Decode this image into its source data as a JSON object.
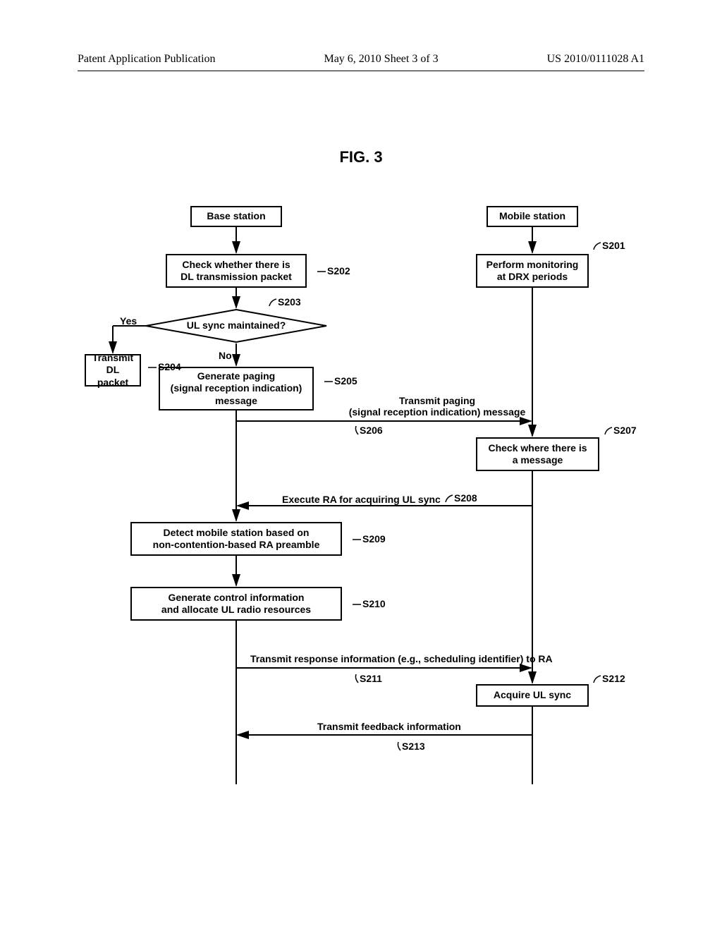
{
  "header": {
    "left": "Patent Application Publication",
    "center": "May 6, 2010  Sheet 3 of 3",
    "right": "US 2010/0111028 A1"
  },
  "figure_title": "FIG. 3",
  "boxes": {
    "base_station": "Base station",
    "mobile_station": "Mobile station",
    "s202": "Check whether there is\nDL transmission packet",
    "s201": "Perform monitoring\nat DRX periods",
    "s203": "UL sync maintained?",
    "s204": "Transmit\nDL packet",
    "s205": "Generate paging\n(signal reception indication)\nmessage",
    "s207": "Check where there is\na message",
    "s209": "Detect mobile station based on\nnon-contention-based RA preamble",
    "s210": "Generate control information\nand allocate UL radio resources",
    "s212": "Acquire UL sync"
  },
  "labels": {
    "yes": "Yes",
    "no": "No",
    "s201": "S201",
    "s202": "S202",
    "s203": "S203",
    "s204": "S204",
    "s205": "S205",
    "s206": "S206",
    "s207": "S207",
    "s208": "S208",
    "s209": "S209",
    "s210": "S210",
    "s211": "S211",
    "s212": "S212",
    "s213": "S213",
    "msg_paging": "Transmit paging\n(signal reception indication) message",
    "msg_ra": "Execute RA for acquiring UL sync",
    "msg_response": "Transmit response information (e.g., scheduling identifier) to RA",
    "msg_feedback": "Transmit feedback information"
  }
}
